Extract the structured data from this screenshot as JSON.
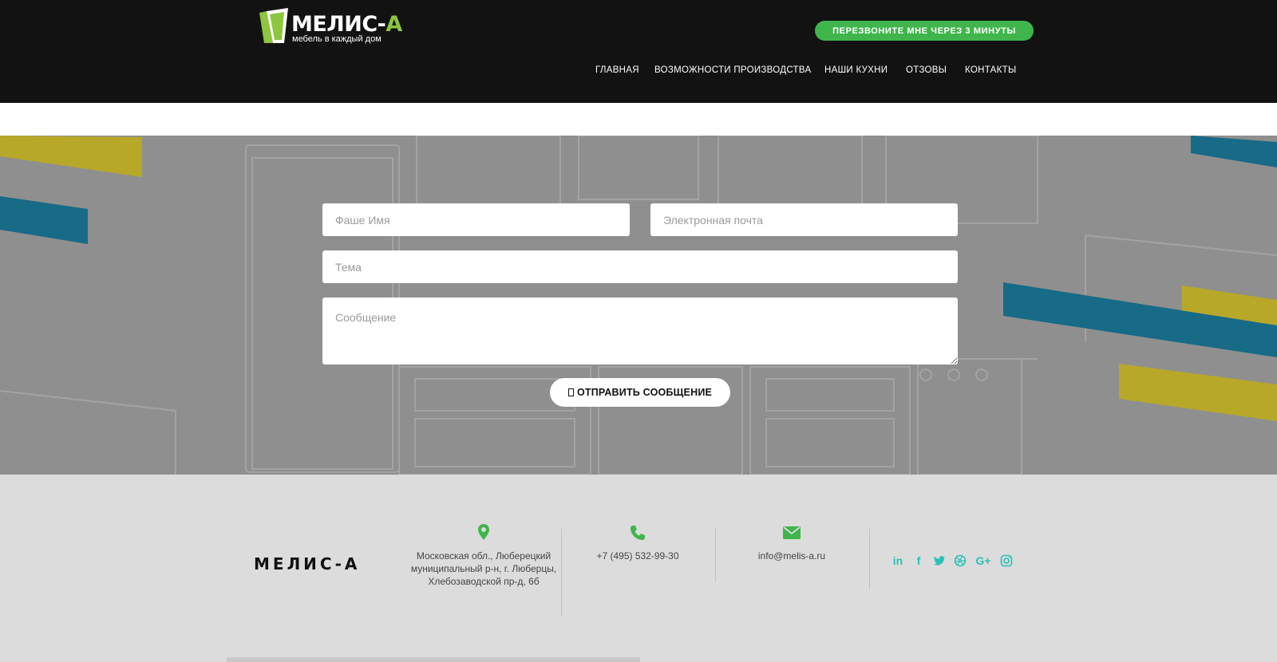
{
  "header": {
    "logo": {
      "name_main": "МЕЛИС-",
      "name_accent": "А",
      "tagline": "мебель в каждый дом"
    },
    "callback_label": "ПЕРЕЗВОНИТЕ МНЕ ЧЕРЕЗ 3 МИНУТЫ",
    "nav": [
      {
        "label": "ГЛАВНАЯ"
      },
      {
        "label": "ВОЗМОЖНОСТИ ПРОИЗВОДСТВА"
      },
      {
        "label": "НАШИ КУХНИ"
      },
      {
        "label": "ОТЗОВЫ"
      },
      {
        "label": "КОНТАКТЫ"
      }
    ]
  },
  "form": {
    "name_placeholder": "Фаше Имя",
    "email_placeholder": "Электронная почта",
    "subject_placeholder": "Тема",
    "message_placeholder": "Сообщение",
    "send_label": "ОТПРАВИТЬ СООБЩЕНИЕ"
  },
  "footer": {
    "brand": "МЕЛИС-А",
    "address": "Московская обл., Люберецкий муниципальный р-н, г. Люберцы, Хлебозаводской пр-д, 6б",
    "phone": "+7 (495) 532-99-30",
    "email": "info@melis-a.ru",
    "socials": [
      "linkedin-icon",
      "facebook-icon",
      "twitter-icon",
      "dribbble-icon",
      "google-plus-icon",
      "instagram-icon"
    ]
  },
  "colors": {
    "header_bg": "#121212",
    "accent_green": "#3fb54b",
    "logo_green": "#8dc63f",
    "stripe_yellow": "#b8a82a",
    "stripe_teal": "#176b86",
    "social_teal": "#27c2b5",
    "footer_bg": "#dcdcdc"
  }
}
